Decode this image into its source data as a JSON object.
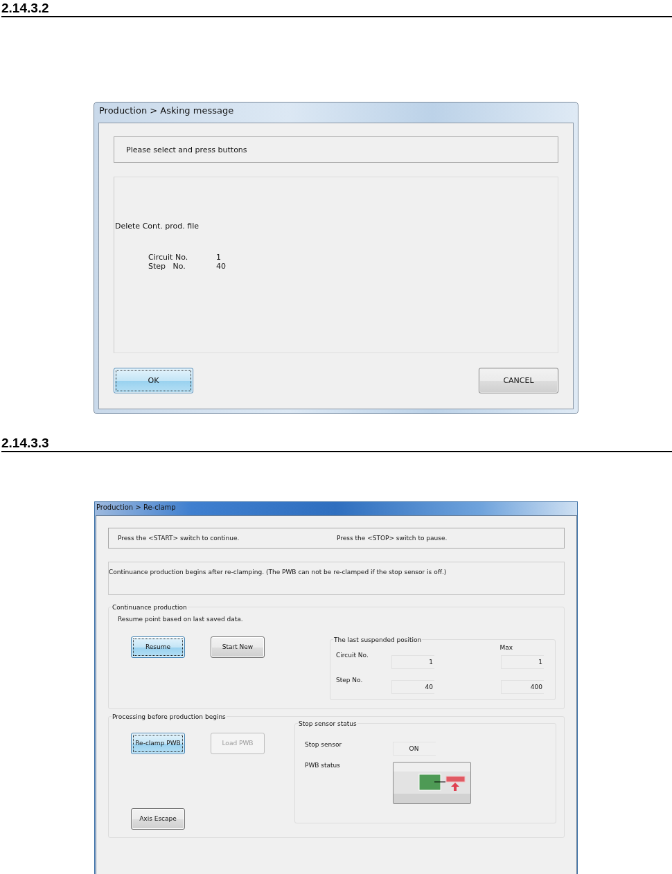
{
  "section_1": {
    "heading": "2.14.3.2",
    "window": {
      "title": "Production > Asking message",
      "message": "Please select and press buttons",
      "body_title": "Delete Cont. prod. file",
      "details": [
        {
          "label": "Circuit No.",
          "value": "1"
        },
        {
          "label": "Step   No.",
          "value": "40"
        }
      ],
      "buttons": [
        {
          "label": "OK",
          "focused": true
        },
        {
          "label": "CANCEL",
          "focused": false
        }
      ]
    }
  },
  "section_2": {
    "heading": "2.14.3.3",
    "window": {
      "title": "Production > Re-clamp",
      "messages": [
        "Press the <START> switch to continue.",
        "Press the <STOP> switch to pause."
      ],
      "info": "Continuance production begins after re-clamping. (The PWB can not be re-clamped if the stop sensor is off.)",
      "continuance": {
        "legend": "Continuance production",
        "note": "Resume point based on last saved data.",
        "buttons": [
          {
            "label": "Resume",
            "focused": true,
            "disabled": false
          },
          {
            "label": "Start New",
            "focused": false,
            "disabled": false
          }
        ],
        "position": {
          "legend": "The last suspended position",
          "max_label": "Max",
          "rows": [
            {
              "label": "Circuit No.",
              "value": "1",
              "max": "1"
            },
            {
              "label": "Step No.",
              "value": "40",
              "max": "400"
            }
          ]
        }
      },
      "processing": {
        "legend": "Processing before production begins",
        "buttons": [
          {
            "label": "Re-clamp PWB",
            "focused": true,
            "disabled": false
          },
          {
            "label": "Load PWB",
            "focused": false,
            "disabled": true
          }
        ],
        "escape_button": {
          "label": "Axis Escape",
          "focused": false,
          "disabled": false
        },
        "sensor": {
          "legend": "Stop sensor status",
          "stop_sensor_label": "Stop sensor",
          "stop_sensor_value": "ON",
          "pwb_status_label": "PWB status"
        }
      }
    }
  }
}
